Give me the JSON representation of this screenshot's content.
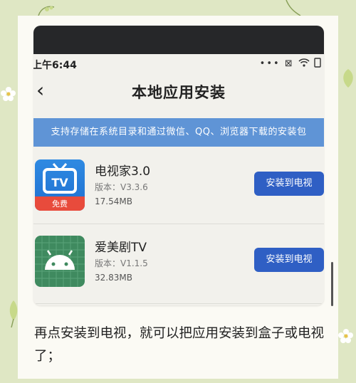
{
  "status_bar": {
    "time": "上午6:44",
    "icons": [
      "signal-dots-icon",
      "x-box-icon",
      "wifi-icon",
      "battery-icon"
    ]
  },
  "nav": {
    "back_icon": "chevron-left-icon",
    "title": "本地应用安装"
  },
  "banner": {
    "text": "支持存储在系统目录和通过微信、QQ、浏览器下载的安装包"
  },
  "apps": [
    {
      "icon": "tv-app-icon",
      "name": "电视家3.0",
      "version": "版本：V3.3.6",
      "size": "17.54MB",
      "button": "安装到电视",
      "badge": "免费"
    },
    {
      "icon": "android-icon",
      "name": "爱美剧TV",
      "version": "版本：V1.1.5",
      "size": "32.83MB",
      "button": "安装到电视"
    }
  ],
  "caption": "再点安装到电视，就可以把应用安装到盒子或电视了；",
  "colors": {
    "background": "#dfe7c4",
    "banner": "#5f94d6",
    "button": "#2f5fc4"
  }
}
